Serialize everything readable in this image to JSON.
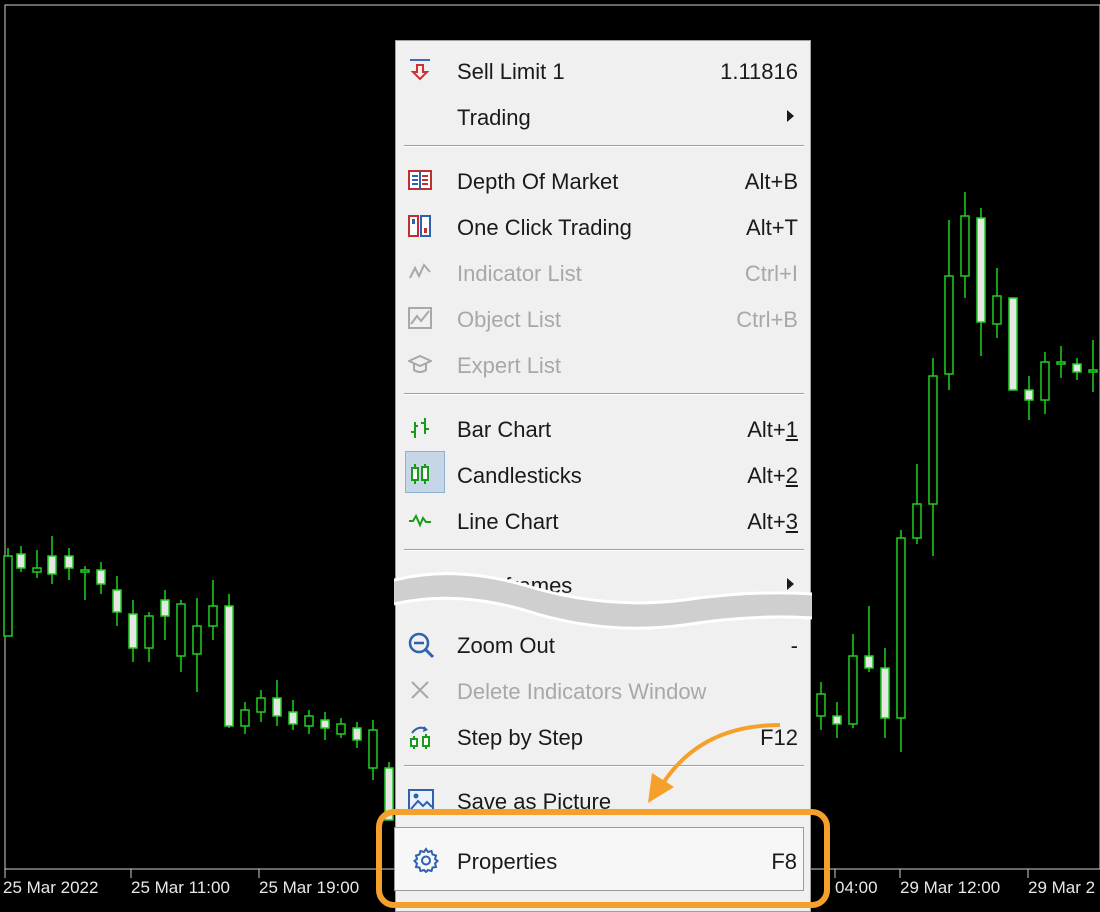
{
  "chart": {
    "time_labels": [
      "25 Mar 2022",
      "25 Mar 11:00",
      "25 Mar 19:00",
      "04:00",
      "29 Mar 12:00",
      "29 Mar 2"
    ]
  },
  "menu": {
    "items": [
      {
        "label": "Sell Limit 1",
        "shortcut": "1.11816",
        "icon": "sell-limit-arrow-icon",
        "disabled": false
      },
      {
        "label": "Trading",
        "submenu": true,
        "disabled": false
      },
      {
        "label": "Depth Of Market",
        "shortcut": "Alt+B",
        "icon": "depth-of-market-icon",
        "disabled": false
      },
      {
        "label": "One Click Trading",
        "shortcut": "Alt+T",
        "icon": "one-click-trading-icon",
        "disabled": false
      },
      {
        "label": "Indicator List",
        "shortcut": "Ctrl+I",
        "icon": "indicator-list-icon",
        "disabled": true
      },
      {
        "label": "Object List",
        "shortcut": "Ctrl+B",
        "icon": "object-list-icon",
        "disabled": true
      },
      {
        "label": "Expert List",
        "icon": "expert-list-icon",
        "disabled": true
      },
      {
        "label": "Bar Chart",
        "shortcut_prefix": "Alt+",
        "shortcut_key": "1",
        "icon": "bar-chart-icon",
        "disabled": false
      },
      {
        "label": "Candlesticks",
        "shortcut_prefix": "Alt+",
        "shortcut_key": "2",
        "icon": "candlesticks-icon",
        "disabled": false,
        "selected": true
      },
      {
        "label": "Line Chart",
        "shortcut_prefix": "Alt+",
        "shortcut_key": "3",
        "icon": "line-chart-icon",
        "disabled": false
      },
      {
        "label": "Timeframes",
        "submenu": true,
        "disabled": false
      },
      {
        "label": "Zoom Out",
        "shortcut": "-",
        "icon": "zoom-out-icon",
        "disabled": false
      },
      {
        "label": "Delete Indicators Window",
        "icon": "close-icon",
        "disabled": true
      },
      {
        "label": "Step by Step",
        "shortcut": "F12",
        "icon": "step-by-step-icon",
        "disabled": false
      },
      {
        "label": "Save as Picture",
        "icon": "save-picture-icon",
        "disabled": false
      },
      {
        "label": "Properties",
        "shortcut": "F8",
        "icon": "gear-icon",
        "disabled": false,
        "highlighted": true
      }
    ]
  },
  "colors": {
    "chart_background": "#000000",
    "candle_green": "#1fd11f",
    "highlight_orange": "#f4a02a"
  }
}
